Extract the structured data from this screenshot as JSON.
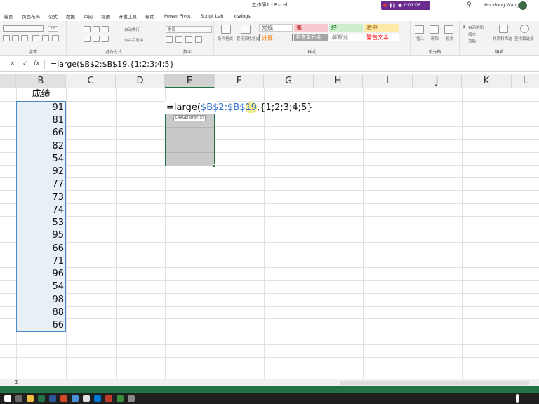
{
  "window": {
    "title": "工作簿1 - Excel",
    "recorder_time": "0:01:06",
    "user_name": "Houdong Wang"
  },
  "ribbon_tabs": [
    "绘图",
    "页面布局",
    "公式",
    "数据",
    "审阅",
    "视图",
    "开发工具",
    "帮助",
    "Power Pivot",
    "Script Lab",
    "xlwings"
  ],
  "ribbon": {
    "groups": [
      "字体",
      "对齐方式",
      "数字",
      "样式",
      "单元格",
      "编辑"
    ],
    "font_size": "18",
    "wrap_text": "自动换行",
    "merge_center": "合并后居中",
    "number_format": "常规",
    "conditional_format": "条件格式",
    "format_as_table": "套用表格格式",
    "cell_styles": [
      "常规",
      "差",
      "好",
      "适中",
      "计算",
      "检查单元格",
      "解释性...",
      "警告文本"
    ],
    "cells_buttons": [
      "插入",
      "删除",
      "格式"
    ],
    "autosum": "自动求和",
    "fill": "填充",
    "clear": "清除",
    "sort_filter": "排序和筛选",
    "find_select": "查找和选择"
  },
  "formula_bar": {
    "cancel_symbol": "×",
    "enter_symbol": "✓",
    "fx_symbol": "fx",
    "formula": "=large($B$2:$B$19,{1;2;3;4;5}"
  },
  "columns": [
    "B",
    "C",
    "D",
    "E",
    "F",
    "G",
    "H",
    "I",
    "J",
    "K",
    "L"
  ],
  "column_b": {
    "header": "成绩",
    "values": [
      91,
      81,
      66,
      82,
      54,
      92,
      77,
      73,
      74,
      53,
      95,
      66,
      71,
      96,
      54,
      98,
      88,
      66
    ]
  },
  "edit_cell": {
    "prefix": "=large(",
    "ref_part1": "$B$2:$B$",
    "ref_part2": "19",
    "suffix": ",{1;2;3;4;5}",
    "tooltip": "LARGE(array, k)"
  },
  "sheet_bar": {
    "add_sheet_symbol": "⊕"
  },
  "colors": {
    "excel_green": "#217346",
    "selection_blue": "#4a88c7",
    "reference_blue": "#2e6fd1",
    "recorder_purple": "#6b2c8f"
  }
}
